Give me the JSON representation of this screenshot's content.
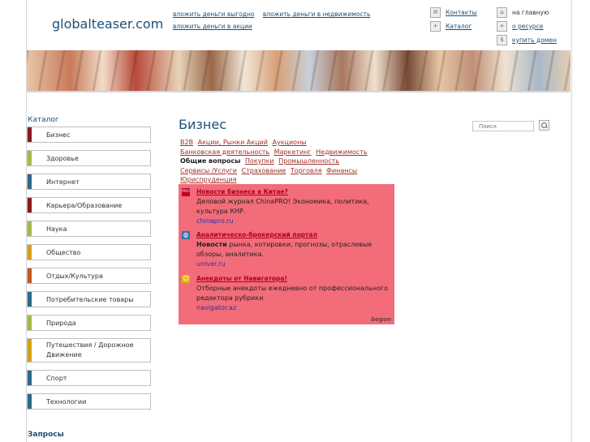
{
  "site": {
    "title": "globalteaser.com"
  },
  "top_links": {
    "row1": [
      "вложить деньги выгодно",
      "вложить деньги в недвижимость"
    ],
    "row2": [
      "вложить деньги в акции"
    ]
  },
  "utility": {
    "col1": [
      {
        "label": "Контакты",
        "icon": "mail-icon"
      },
      {
        "label": "Каталог",
        "icon": "plus-icon"
      }
    ],
    "col2": [
      {
        "label": "на главную",
        "icon": "home-icon",
        "link": false
      },
      {
        "label": "о ресурсе",
        "icon": "plus-icon",
        "link": true
      },
      {
        "label": "купить домен",
        "icon": "dollar-icon",
        "link": true
      }
    ]
  },
  "sidebar": {
    "heading": "Каталог",
    "items": [
      {
        "label": "Бизнес",
        "color": "#8b1a1a"
      },
      {
        "label": "Здоровье",
        "color": "#a6b84a"
      },
      {
        "label": "Интернет",
        "color": "#2d6a8a"
      },
      {
        "label": "Карьера/Образование",
        "color": "#8b1a1a"
      },
      {
        "label": "Наука",
        "color": "#a6b84a"
      },
      {
        "label": "Общество",
        "color": "#d4a017"
      },
      {
        "label": "Отдых/Культура",
        "color": "#c4571a"
      },
      {
        "label": "Потребительские товары",
        "color": "#2d6a8a"
      },
      {
        "label": "Природа",
        "color": "#a6b84a"
      },
      {
        "label": "Путешествия / Дорожное Движение",
        "color": "#d4a017"
      },
      {
        "label": "Спорт",
        "color": "#2d6a8a"
      },
      {
        "label": "Технологии",
        "color": "#2d6a8a"
      }
    ],
    "requests_heading": "Запросы"
  },
  "main": {
    "title": "Бизнес",
    "search_placeholder": "Поиск",
    "tags": [
      {
        "label": "B2B",
        "active": false
      },
      {
        "label": "Акции, Рынки Акций",
        "active": false
      },
      {
        "label": "Аукционы",
        "active": false
      },
      {
        "label": "Банковская деятельность",
        "active": false
      },
      {
        "label": "Маркетинг",
        "active": false
      },
      {
        "label": "Недвижимость",
        "active": false
      },
      {
        "label": "Общие вопросы",
        "active": true
      },
      {
        "label": "Покупки",
        "active": false
      },
      {
        "label": "Промышленность",
        "active": false
      },
      {
        "label": "Сервисы /Услуги",
        "active": false
      },
      {
        "label": "Страхование",
        "active": false
      },
      {
        "label": "Торговля",
        "active": false
      },
      {
        "label": "Финансы",
        "active": false
      },
      {
        "label": "Юриспруденция",
        "active": false
      }
    ],
    "ads": [
      {
        "title": "Новости бизнеса в Китае?",
        "text_bold": "",
        "text": "Деловой журнал ChinaPRO! Экономика, политика, культура КНР.",
        "url": "chinapro.ru",
        "icon": "pro-icon"
      },
      {
        "title": "Аналитическо-брокерский портал",
        "text_bold": "Новости",
        "text": " рынка, котировки, прогнозы, отраслевые обзоры, аналитика.",
        "url": "univer.ru",
        "icon": "globe-icon"
      },
      {
        "title": "Анекдоты от Навигатора!",
        "text_bold": "",
        "text": "Отборные анекдоты ежедневно от профессионального редактора рубрики",
        "url": "navigator.az",
        "icon": "smile-icon"
      }
    ],
    "ad_brand": "begun",
    "ad_bg": "#f26c7a"
  }
}
